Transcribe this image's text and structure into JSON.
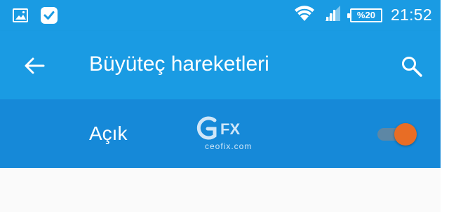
{
  "status_bar": {
    "battery_level": "%20",
    "time": "21:52"
  },
  "app_bar": {
    "title": "Büyüteç hareketleri"
  },
  "master_switch": {
    "label": "Açık",
    "state": "on",
    "accent_color": "#e86d25"
  },
  "watermark": {
    "logo_text": "CEFX",
    "site": "ceofix.com"
  },
  "colors": {
    "primary": "#1a9be3",
    "switch_bar": "#1689d8",
    "background": "#fafafa"
  }
}
